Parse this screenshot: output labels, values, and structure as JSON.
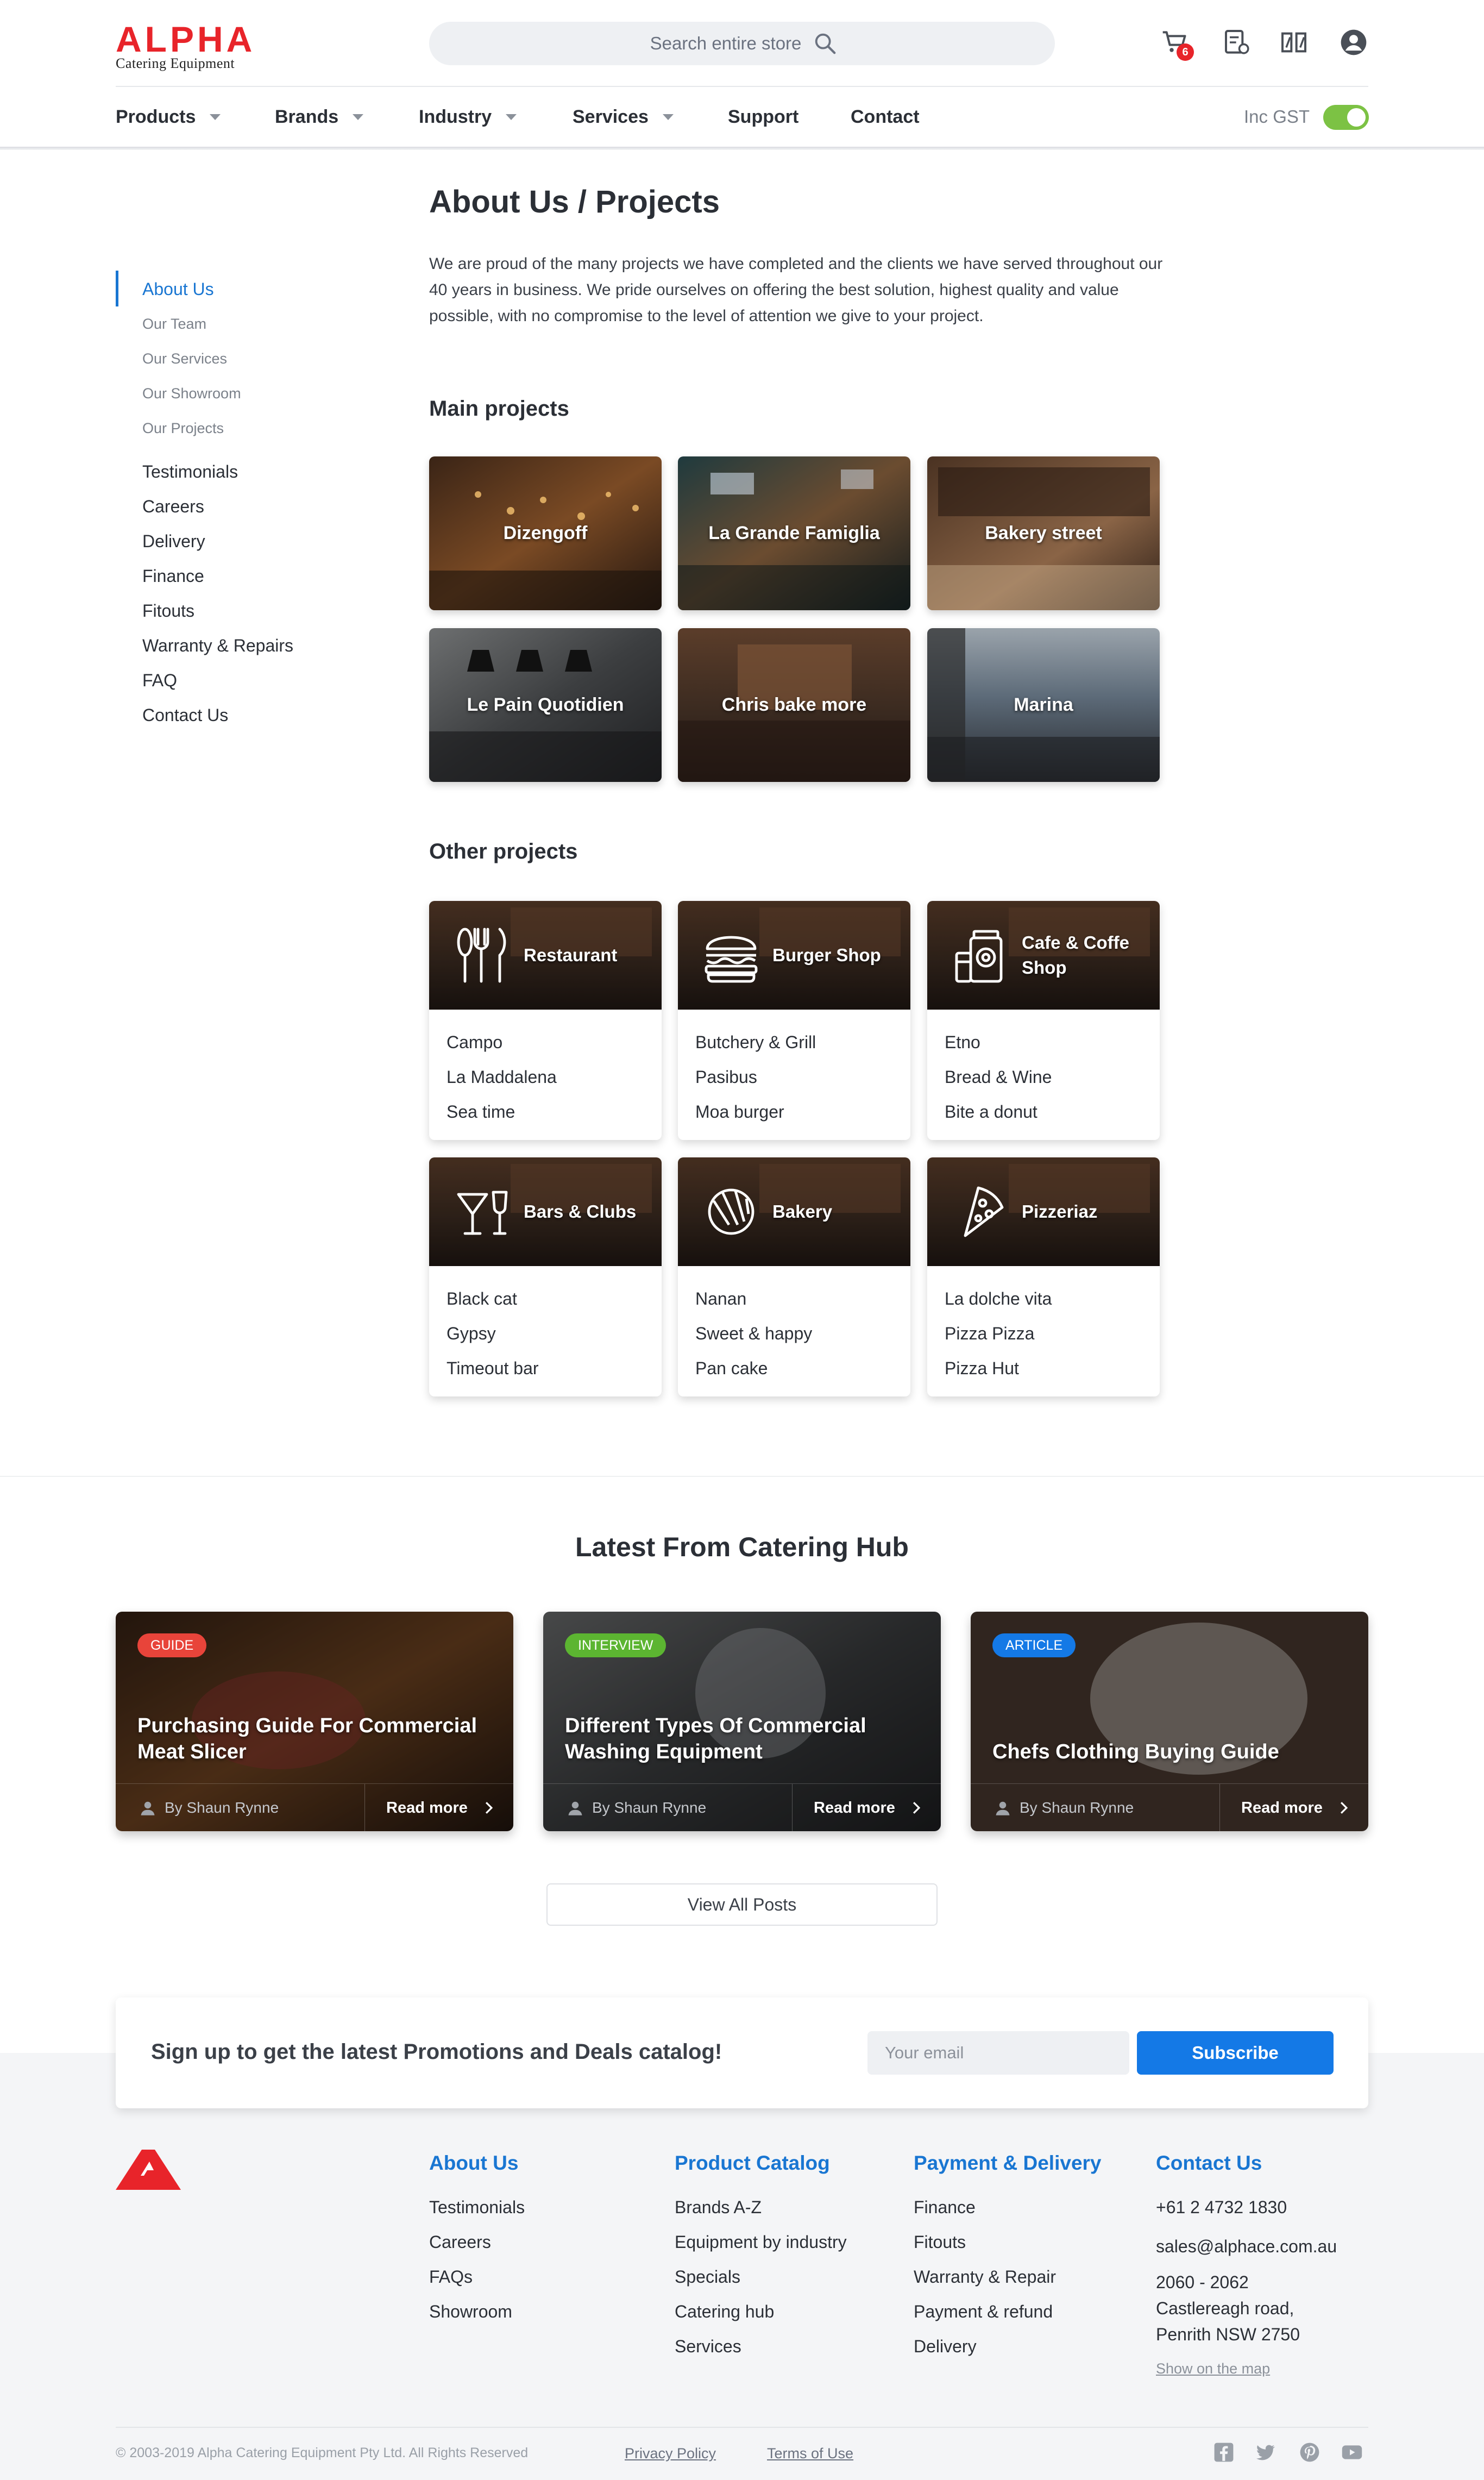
{
  "header": {
    "logo_word": "ALPHA",
    "logo_sub": "Catering Equipment",
    "search_placeholder": "Search entire store",
    "cart_count": "6"
  },
  "nav": {
    "items": [
      "Products",
      "Brands",
      "Industry",
      "Services",
      "Support",
      "Contact"
    ],
    "gst_label": "Inc GST",
    "gst_toggle_on": true
  },
  "sidebar": {
    "about": "About Us",
    "sub_items": [
      "Our Team",
      "Our Services",
      "Our Showroom",
      "Our Projects"
    ],
    "items": [
      "Testimonials",
      "Careers",
      "Delivery",
      "Finance",
      "Fitouts",
      "Warranty & Repairs",
      "FAQ",
      "Contact Us"
    ]
  },
  "main": {
    "title": "About Us / Projects",
    "intro": "We are proud of the many projects we have completed and the clients we have served throughout our 40 years in business. We pride ourselves on offering the best solution, highest quality and value possible, with no compromise to the level of attention we give to your project.",
    "main_projects_heading": "Main projects",
    "main_projects": [
      "Dizengoff",
      "La Grande Famiglia",
      "Bakery street",
      "Le Pain Quotidien",
      "Chris bake more",
      "Marina"
    ],
    "other_projects_heading": "Other projects",
    "categories": [
      {
        "name": "Restaurant",
        "icon": "cutlery-icon",
        "items": [
          "Campo",
          "La Maddalena",
          "Sea time"
        ]
      },
      {
        "name": "Burger Shop",
        "icon": "burger-icon",
        "items": [
          "Butchery & Grill",
          "Pasibus",
          "Moa burger"
        ]
      },
      {
        "name": "Cafe & Coffe Shop",
        "icon": "coffee-jar-icon",
        "items": [
          "Etno",
          "Bread & Wine",
          "Bite a donut"
        ]
      },
      {
        "name": "Bars & Clubs",
        "icon": "cocktail-glass-icon",
        "items": [
          "Black cat",
          "Gypsy",
          "Timeout bar"
        ]
      },
      {
        "name": "Bakery",
        "icon": "croissant-icon",
        "items": [
          "Nanan",
          "Sweet & happy",
          "Pan cake"
        ]
      },
      {
        "name": "Pizzeriaz",
        "icon": "pizza-slice-icon",
        "items": [
          "La dolche vita",
          "Pizza Pizza",
          "Pizza Hut"
        ]
      }
    ]
  },
  "hub": {
    "title": "Latest From Catering Hub",
    "posts": [
      {
        "badge": "GUIDE",
        "badge_color": "#e8443a",
        "title": "Purchasing Guide For Commercial Meat Slicer",
        "author": "By Shaun Rynne",
        "more": "Read more"
      },
      {
        "badge": "INTERVIEW",
        "badge_color": "#5cb531",
        "title": "Different Types Of Commercial Washing Equipment",
        "author": "By Shaun Rynne",
        "more": "Read more"
      },
      {
        "badge": "ARTICLE",
        "badge_color": "#1479e6",
        "title": "Chefs Clothing Buying Guide",
        "author": "By Shaun Rynne",
        "more": "Read more"
      }
    ],
    "view_all": "View All Posts"
  },
  "newsletter": {
    "text": "Sign up to get the latest Promotions and Deals catalog!",
    "email_placeholder": "Your email",
    "button": "Subscribe"
  },
  "footer": {
    "columns": [
      {
        "title": "About Us",
        "links": [
          "Testimonials",
          "Careers",
          "FAQs",
          "Showroom"
        ]
      },
      {
        "title": "Product Catalog",
        "links": [
          "Brands A-Z",
          "Equipment by industry",
          "Specials",
          "Catering hub",
          "Services"
        ]
      },
      {
        "title": "Payment & Delivery",
        "links": [
          "Finance",
          "Fitouts",
          "Warranty & Repair",
          "Payment & refund",
          "Delivery"
        ]
      }
    ],
    "contact": {
      "title": "Contact Us",
      "phone": "+61 2 4732 1830",
      "email": "sales@alphace.com.au",
      "address_1": "2060 - 2062",
      "address_2": "Castlereagh road,",
      "address_3": "Penrith NSW 2750",
      "map_link": "Show on the map"
    },
    "copyright": "© 2003-2019 Alpha Catering Equipment Pty Ltd. All Rights Reserved",
    "privacy": "Privacy Policy",
    "terms": "Terms of Use",
    "social": [
      "facebook-icon",
      "twitter-icon",
      "pinterest-icon",
      "youtube-icon"
    ]
  },
  "colors": {
    "brand_red": "#e8242a",
    "link_blue": "#1976d2",
    "button_blue": "#1479e6",
    "toggle_green": "#7cc244"
  }
}
